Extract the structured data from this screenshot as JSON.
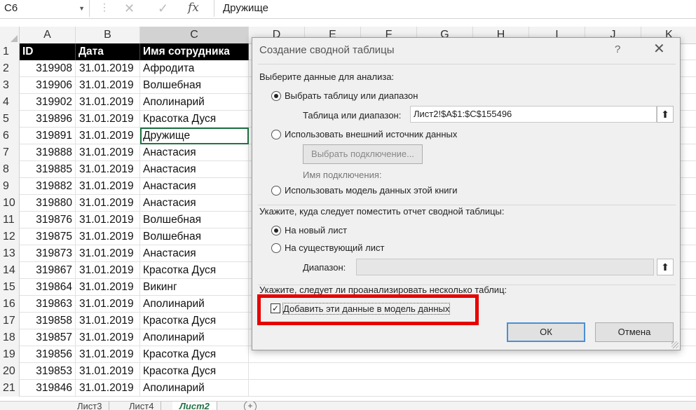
{
  "formula_bar": {
    "name_box": "C6",
    "content": "Дружище",
    "fx": "fx"
  },
  "columns": [
    "A",
    "B",
    "C",
    "D",
    "E",
    "F",
    "G",
    "H",
    "I",
    "J",
    "K"
  ],
  "rows_header": [
    "1",
    "2",
    "3",
    "4",
    "5",
    "6",
    "7",
    "8",
    "9",
    "10",
    "11",
    "12",
    "13",
    "14",
    "15",
    "16",
    "17",
    "18",
    "19",
    "20",
    "21"
  ],
  "header_row": {
    "a": "ID",
    "b": "Дата",
    "c": "Имя сотрудника"
  },
  "data_rows": [
    {
      "a": "319908",
      "b": "31.01.2019",
      "c": "Афродита"
    },
    {
      "a": "319906",
      "b": "31.01.2019",
      "c": "Волшебная"
    },
    {
      "a": "319902",
      "b": "31.01.2019",
      "c": "Аполинарий"
    },
    {
      "a": "319896",
      "b": "31.01.2019",
      "c": "Красотка Дуся"
    },
    {
      "a": "319891",
      "b": "31.01.2019",
      "c": "Дружище"
    },
    {
      "a": "319888",
      "b": "31.01.2019",
      "c": "Анастасия"
    },
    {
      "a": "319885",
      "b": "31.01.2019",
      "c": "Анастасия"
    },
    {
      "a": "319882",
      "b": "31.01.2019",
      "c": "Анастасия"
    },
    {
      "a": "319880",
      "b": "31.01.2019",
      "c": "Анастасия"
    },
    {
      "a": "319876",
      "b": "31.01.2019",
      "c": "Волшебная"
    },
    {
      "a": "319875",
      "b": "31.01.2019",
      "c": "Волшебная"
    },
    {
      "a": "319873",
      "b": "31.01.2019",
      "c": "Анастасия"
    },
    {
      "a": "319867",
      "b": "31.01.2019",
      "c": "Красотка Дуся"
    },
    {
      "a": "319864",
      "b": "31.01.2019",
      "c": "Викинг"
    },
    {
      "a": "319863",
      "b": "31.01.2019",
      "c": "Аполинарий"
    },
    {
      "a": "319858",
      "b": "31.01.2019",
      "c": "Красотка Дуся"
    },
    {
      "a": "319857",
      "b": "31.01.2019",
      "c": "Аполинарий"
    },
    {
      "a": "319856",
      "b": "31.01.2019",
      "c": "Красотка Дуся"
    },
    {
      "a": "319853",
      "b": "31.01.2019",
      "c": "Красотка Дуся"
    },
    {
      "a": "319846",
      "b": "31.01.2019",
      "c": "Аполинарий"
    }
  ],
  "sheet_tabs": [
    "Лист3",
    "Лист4",
    "Лист2"
  ],
  "active_sheet": "Лист2",
  "dialog": {
    "title": "Создание сводной таблицы",
    "help": "?",
    "section1": "Выберите данные для анализа:",
    "opt_table": "Выбрать таблицу или диапазон",
    "range_label": "Таблица или диапазон:",
    "range_value": "Лист2!$A$1:$C$155496",
    "opt_external": "Использовать внешний источник данных",
    "choose_conn_btn": "Выбрать подключение...",
    "conn_name_label": "Имя подключения:",
    "opt_datamodel": "Использовать модель данных этой книги",
    "section2": "Укажите, куда следует поместить отчет сводной таблицы:",
    "opt_new_sheet": "На новый лист",
    "opt_existing": "На существующий лист",
    "location_label": "Диапазон:",
    "section3": "Укажите, следует ли проанализировать несколько таблиц:",
    "add_to_model": "Добавить эти данные в модель данных",
    "add_to_model_checked": true,
    "ok": "ОК",
    "cancel": "Отмена"
  },
  "colors": {
    "accent": "#217346",
    "highlight": "#e60000"
  }
}
